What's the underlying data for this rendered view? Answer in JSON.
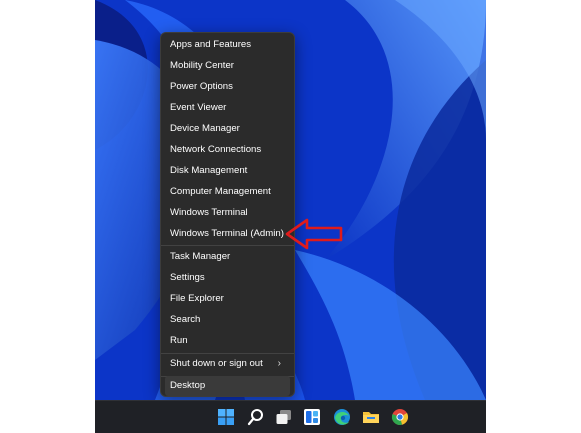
{
  "menu": {
    "items": [
      {
        "label": "Apps and Features"
      },
      {
        "label": "Mobility Center"
      },
      {
        "label": "Power Options"
      },
      {
        "label": "Event Viewer"
      },
      {
        "label": "Device Manager"
      },
      {
        "label": "Network Connections"
      },
      {
        "label": "Disk Management"
      },
      {
        "label": "Computer Management"
      },
      {
        "label": "Windows Terminal"
      },
      {
        "label": "Windows Terminal (Admin)"
      },
      {
        "label": "Task Manager"
      },
      {
        "label": "Settings"
      },
      {
        "label": "File Explorer"
      },
      {
        "label": "Search"
      },
      {
        "label": "Run"
      },
      {
        "label": "Shut down or sign out",
        "submenu_indicator": "›"
      },
      {
        "label": "Desktop"
      }
    ]
  },
  "annotation": {
    "icon": "red-outline-arrow-pointing-left",
    "color": "#e01b1b",
    "target": "Windows Terminal (Admin)"
  },
  "taskbar": {
    "icons": [
      "windows-start-icon",
      "search-icon",
      "task-view-icon",
      "widgets-icon",
      "edge-browser-icon",
      "file-explorer-icon",
      "chrome-browser-icon"
    ]
  }
}
